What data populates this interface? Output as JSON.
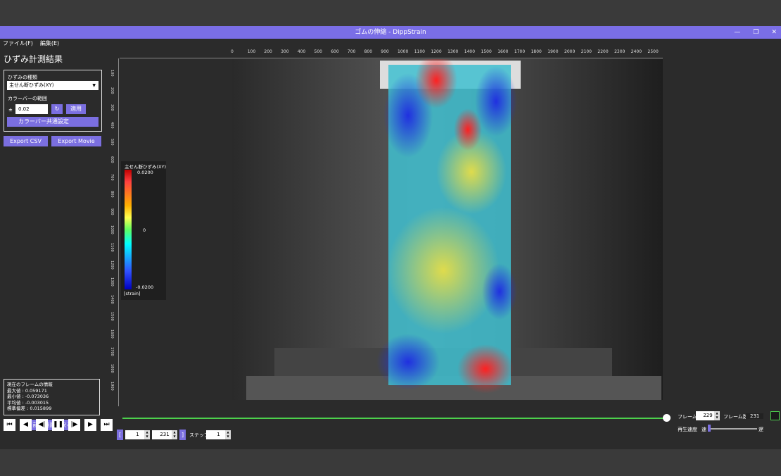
{
  "window": {
    "title": "ゴムの伸縮 - DippStrain",
    "min": "—",
    "max": "❐",
    "close": "✕"
  },
  "menu": {
    "file": "ファイル(F)",
    "edit": "編集(E)"
  },
  "panel": {
    "title": "ひずみ計測結果",
    "strain_type_label": "ひずみの種類",
    "strain_type_value": "主せん断ひずみ(XY)",
    "colorbar_range_label": "カラーバーの範囲",
    "pm": "±",
    "range_value": "0.02",
    "apply": "適用",
    "common_settings": "カラーバー共通設定",
    "export_csv": "Export CSV",
    "export_movie": "Export Movie"
  },
  "frame_info": {
    "title": "現在のフレームの情報",
    "max": "最大値 : 0.059171",
    "min": "最小値 : -0.073036",
    "mean": "平均値 : -0.003015",
    "std": "標準偏差 : 0.015899"
  },
  "back": "前の画面に戻る",
  "ruler_top": [
    "0",
    "100",
    "200",
    "300",
    "400",
    "500",
    "600",
    "700",
    "800",
    "900",
    "1000",
    "1100",
    "1200",
    "1300",
    "1400",
    "1500",
    "1600",
    "1700",
    "1800",
    "1900",
    "2000",
    "2100",
    "2200",
    "2300",
    "2400",
    "2500"
  ],
  "ruler_left": [
    "100",
    "200",
    "300",
    "400",
    "500",
    "600",
    "700",
    "800",
    "900",
    "1000",
    "1100",
    "1200",
    "1300",
    "1400",
    "1500",
    "1600",
    "1700",
    "1800",
    "1900"
  ],
  "colorbar": {
    "title": "主せん断ひずみ(XY)",
    "max": "0.0200",
    "zero": "0",
    "min": "-0.0200",
    "unit": "[strain]"
  },
  "playback": {
    "frame_label": "フレーム",
    "frame": "229",
    "frame_count_label": "フレーム数",
    "frame_count": "231",
    "speed_label": "再生速度",
    "fast": "速",
    "slow": "遅",
    "start": "1",
    "end": "231",
    "step_label": "ステップ",
    "step": "1",
    "bracket_l": "[",
    "bracket_r": "]"
  }
}
